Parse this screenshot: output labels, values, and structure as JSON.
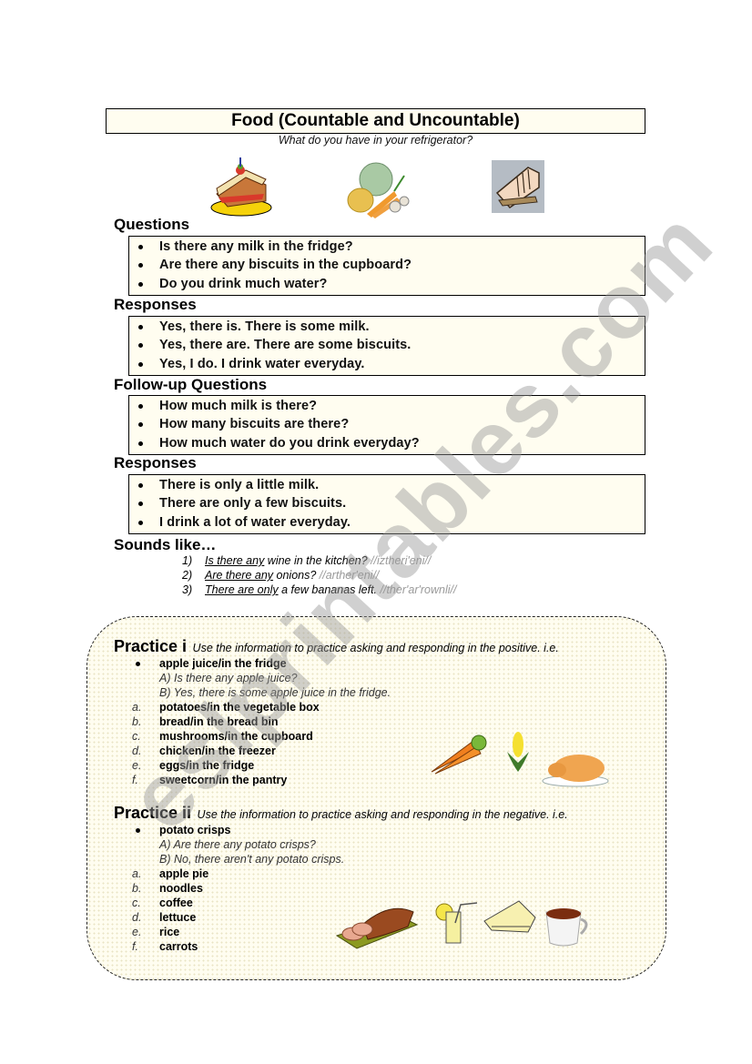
{
  "header": {
    "title": "Food (Countable and Uncountable)",
    "subtitle": "What do you have in your refrigerator?"
  },
  "sections": [
    {
      "heading": "Questions",
      "items": [
        "Is there any milk in the fridge?",
        "Are there any biscuits in the cupboard?",
        "Do you drink much water?"
      ]
    },
    {
      "heading": "Responses",
      "items": [
        "Yes, there is. There is some milk.",
        "Yes, there are. There are some biscuits.",
        "Yes, I do. I drink water everyday."
      ]
    },
    {
      "heading": "Follow-up Questions",
      "items": [
        "How much milk is there?",
        "How many biscuits are there?",
        "How much water do you drink everyday?"
      ]
    },
    {
      "heading": "Responses",
      "items": [
        "There is only a little milk.",
        "There are only a few biscuits.",
        "I drink a lot of water everyday."
      ]
    }
  ],
  "sounds_like": {
    "heading": "Sounds like…",
    "items": [
      {
        "num": "1)",
        "underlined": "Is there any",
        "rest": " wine in the kitchen? ",
        "ipa": "//iztheri'eni//"
      },
      {
        "num": "2)",
        "underlined": "Are there any",
        "rest": " onions? ",
        "ipa": "//arther'eni//"
      },
      {
        "num": "3)",
        "underlined": "There are only",
        "rest": " a few bananas left. ",
        "ipa": "//ther'ar'rownli//"
      }
    ]
  },
  "practice_1": {
    "heading": "Practice i",
    "instruction": "Use the information to practice asking and responding in the positive. i.e.",
    "example": {
      "item": "apple juice/in the fridge",
      "a": "A) Is there any apple juice?",
      "b": "B) Yes, there is some apple juice in the fridge."
    },
    "items": [
      {
        "marker": "a.",
        "text": "potatoes/in the vegetable box"
      },
      {
        "marker": "b.",
        "text": "bread/in the bread bin"
      },
      {
        "marker": "c.",
        "text": "mushrooms/in the cupboard"
      },
      {
        "marker": "d.",
        "text": "chicken/in the freezer"
      },
      {
        "marker": "e.",
        "text": "eggs/in the fridge"
      },
      {
        "marker": "f.",
        "text": "sweetcorn/in the pantry"
      }
    ]
  },
  "practice_2": {
    "heading": "Practice ii",
    "instruction": "Use the information to practice asking and responding in the negative. i.e.",
    "example": {
      "item": "potato crisps",
      "a": "A) Are there any potato crisps?",
      "b": "B) No, there aren't any potato crisps."
    },
    "items": [
      {
        "marker": "a.",
        "text": "apple pie"
      },
      {
        "marker": "b.",
        "text": "noodles"
      },
      {
        "marker": "c.",
        "text": "coffee"
      },
      {
        "marker": "d.",
        "text": "lettuce"
      },
      {
        "marker": "e.",
        "text": "rice"
      },
      {
        "marker": "f.",
        "text": "carrots"
      }
    ]
  },
  "images": [
    "sandwich-clipart",
    "vegetables-clipart",
    "ham-clipart",
    "carrots-clipart",
    "corn-clipart",
    "roast-chicken-clipart",
    "sliced-loaf-clipart",
    "lemonade-clipart",
    "apple-pie-clipart",
    "tea-cup-clipart"
  ],
  "watermark": "eslprintables.com"
}
